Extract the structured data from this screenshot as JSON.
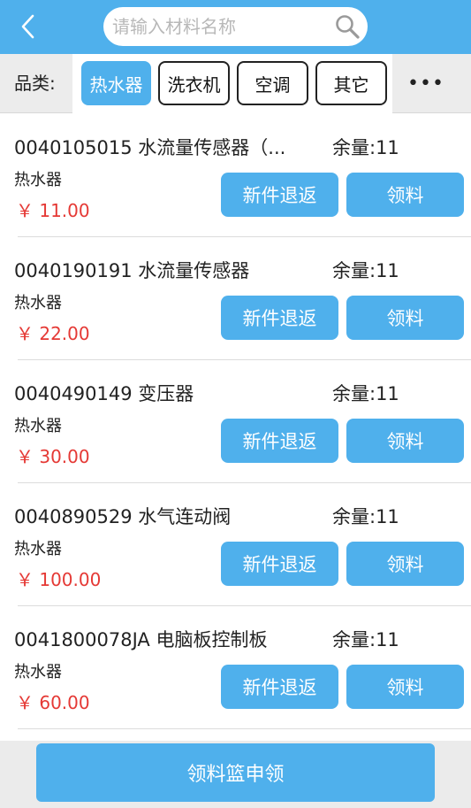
{
  "header": {
    "back_icon": "chevron-left-icon",
    "search": {
      "placeholder": "请输入材料名称",
      "value": "",
      "icon": "search-icon"
    }
  },
  "filter": {
    "label": "品类:",
    "chips": [
      {
        "label": "热水器",
        "active": true
      },
      {
        "label": "洗衣机",
        "active": false
      },
      {
        "label": "空调",
        "active": false
      },
      {
        "label": "其它",
        "active": false
      }
    ],
    "more_label": "•••"
  },
  "items": [
    {
      "name": "0040105015 水流量传感器（...",
      "stock": "余量:11",
      "category": "热水器",
      "price": "￥ 11.00",
      "return_label": "新件退返",
      "take_label": "领料"
    },
    {
      "name": "0040190191 水流量传感器",
      "stock": "余量:11",
      "category": "热水器",
      "price": "￥ 22.00",
      "return_label": "新件退返",
      "take_label": "领料"
    },
    {
      "name": "0040490149 变压器",
      "stock": "余量:11",
      "category": "热水器",
      "price": "￥ 30.00",
      "return_label": "新件退返",
      "take_label": "领料"
    },
    {
      "name": "0040890529 水气连动阀",
      "stock": "余量:11",
      "category": "热水器",
      "price": "￥ 100.00",
      "return_label": "新件退返",
      "take_label": "领料"
    },
    {
      "name": "0041800078JA 电脑板控制板",
      "stock": "余量:11",
      "category": "热水器",
      "price": "￥ 60.00",
      "return_label": "新件退返",
      "take_label": "领料"
    }
  ],
  "footer": {
    "submit_label": "领料篮申领"
  },
  "colors": {
    "accent": "#4fb0ec",
    "price": "#e53935",
    "filter_bg": "#ececec"
  }
}
